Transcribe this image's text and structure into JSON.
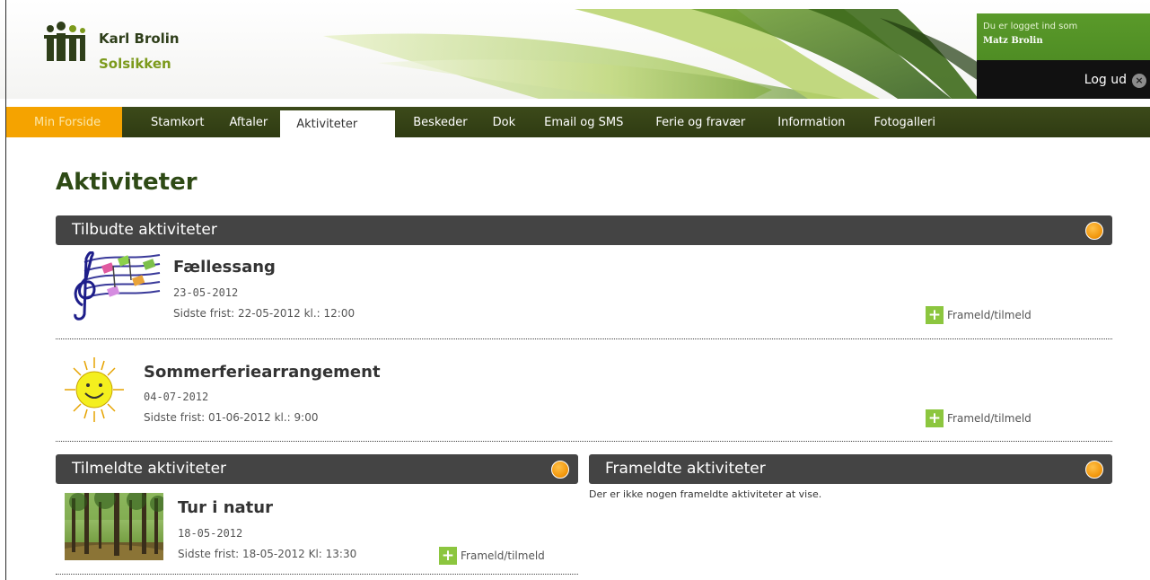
{
  "header": {
    "brand_name": "Karl Brolin",
    "brand_sub": "Solsikken",
    "login_label": "Du er logget ind som",
    "login_user": "Matz Brolin",
    "logout_label": "Log ud",
    "logout_icon": "close-circle-icon"
  },
  "nav": {
    "items": [
      {
        "label": "Min Forside"
      },
      {
        "label": "Stamkort"
      },
      {
        "label": "Aftaler"
      },
      {
        "label": "Aktiviteter"
      },
      {
        "label": "Beskeder"
      },
      {
        "label": "Dok"
      },
      {
        "label": "Email og SMS"
      },
      {
        "label": "Ferie og fravær"
      },
      {
        "label": "Information"
      },
      {
        "label": "Fotogalleri"
      }
    ],
    "active_index": 3
  },
  "page": {
    "title": "Aktiviteter"
  },
  "offered": {
    "title": "Tilbudte aktiviteter",
    "items": [
      {
        "name": "Fællessang",
        "date": "23-05-2012",
        "deadline": "Sidste frist: 22-05-2012 kl.: 12:00",
        "action": "Frameld/tilmeld",
        "icon": "music-notes-icon"
      },
      {
        "name": "Sommerferiearrangement",
        "date": "04-07-2012",
        "deadline": "Sidste frist: 01-06-2012 kl.: 9:00",
        "action": "Frameld/tilmeld",
        "icon": "sun-smiley-icon"
      }
    ]
  },
  "registered": {
    "title": "Tilmeldte aktiviteter",
    "items": [
      {
        "name": "Tur i natur",
        "date": "18-05-2012",
        "deadline": "Sidste frist: 18-05-2012 Kl: 13:30",
        "action": "Frameld/tilmeld",
        "icon": "forest-photo"
      }
    ]
  },
  "unregistered": {
    "title": "Frameldte aktiviteter",
    "empty_text": "Der er ikke nogen frameldte aktiviteter at vise."
  },
  "colors": {
    "nav_bg": "#2f3b12",
    "home_tab": "#f5a300",
    "section_bar": "#444444",
    "accent_green": "#8cc63f",
    "status_dot": "#f39a10"
  }
}
